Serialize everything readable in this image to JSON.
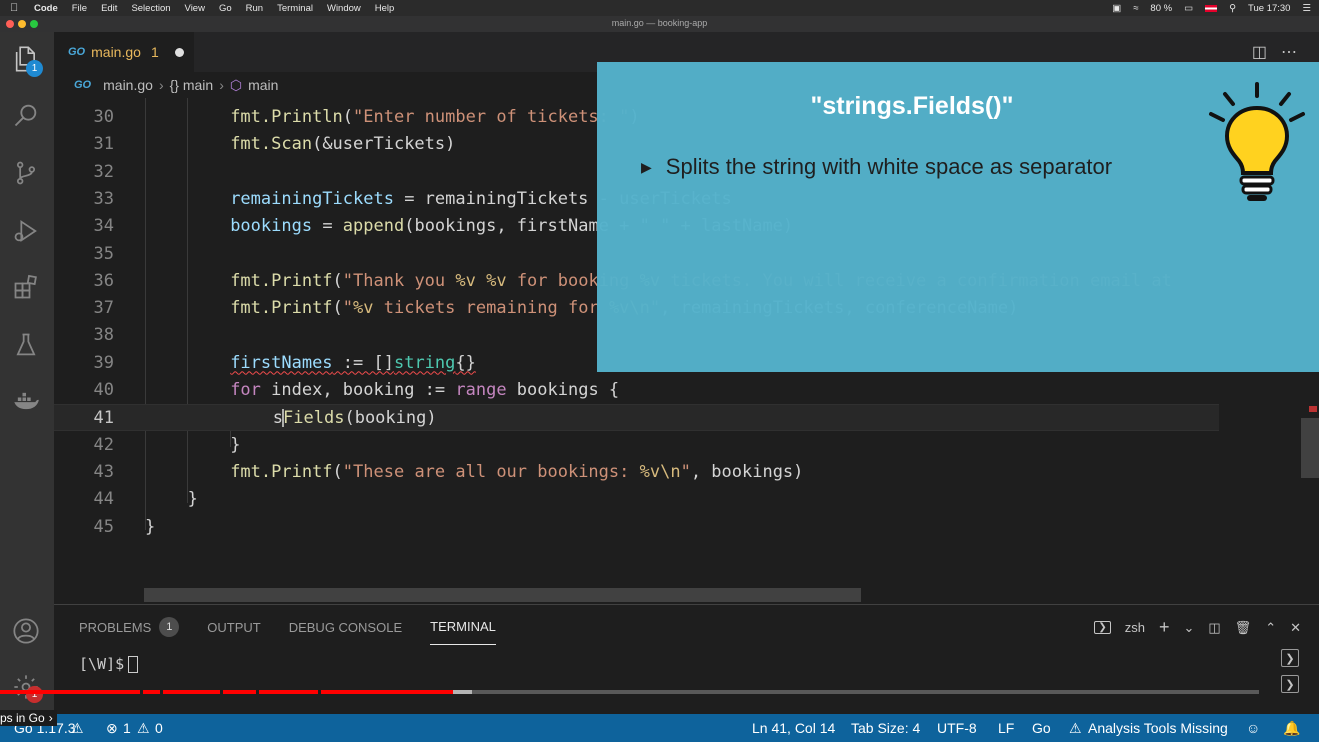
{
  "macos_menubar": {
    "app": "Code",
    "menus": [
      "File",
      "Edit",
      "Selection",
      "View",
      "Go",
      "Run",
      "Terminal",
      "Window",
      "Help"
    ],
    "battery": "80 %",
    "clock": "Tue 17:30"
  },
  "window": {
    "title": "main.go — booking-app"
  },
  "activity_bar": {
    "explorer_badge": "1",
    "settings_badge": "1"
  },
  "tabs": [
    {
      "icon_text": "GO",
      "label": "main.go",
      "problem_count": "1"
    }
  ],
  "breadcrumb": {
    "file": "main.go",
    "func_scope": "{} main",
    "symbol": "main"
  },
  "editor": {
    "lines": [
      {
        "num": "30",
        "tokens": [
          [
            "fn",
            "fmt.Println"
          ],
          [
            "pl",
            "("
          ],
          [
            "str",
            "\"Enter number of tickets: \""
          ],
          [
            "pl",
            ")"
          ]
        ]
      },
      {
        "num": "31",
        "tokens": [
          [
            "fn",
            "fmt.Scan"
          ],
          [
            "pl",
            "(&userTickets)"
          ]
        ]
      },
      {
        "num": "32",
        "tokens": []
      },
      {
        "num": "33",
        "tokens": [
          [
            "var",
            "remainingTickets"
          ],
          [
            "pl",
            " = remainingTickets - userTickets"
          ]
        ]
      },
      {
        "num": "34",
        "tokens": [
          [
            "var",
            "bookings"
          ],
          [
            "pl",
            " = "
          ],
          [
            "fn",
            "append"
          ],
          [
            "pl",
            "(bookings, firstName + \" \" + lastName)"
          ]
        ]
      },
      {
        "num": "35",
        "tokens": []
      },
      {
        "num": "36",
        "tokens": [
          [
            "fn",
            "fmt.Printf"
          ],
          [
            "pl",
            "("
          ],
          [
            "str",
            "\"Thank you "
          ],
          [
            "esc",
            "%v %v"
          ],
          [
            "str",
            " for booking "
          ],
          [
            "esc",
            "%v"
          ],
          [
            "str",
            " tickets. You will receive a confirmation email at"
          ]
        ]
      },
      {
        "num": "37",
        "tokens": [
          [
            "fn",
            "fmt.Printf"
          ],
          [
            "pl",
            "("
          ],
          [
            "str",
            "\""
          ],
          [
            "esc",
            "%v"
          ],
          [
            "str",
            " tickets remaining for "
          ],
          [
            "esc",
            "%v\\n"
          ],
          [
            "str",
            "\""
          ],
          [
            "pl",
            ", remainingTickets, conferenceName)"
          ]
        ]
      },
      {
        "num": "38",
        "tokens": []
      },
      {
        "num": "39",
        "tokens": [
          [
            "var",
            "firstNames"
          ],
          [
            "pl",
            " := []"
          ],
          [
            "type",
            "string"
          ],
          [
            "pl",
            "{}"
          ]
        ]
      },
      {
        "num": "40",
        "tokens": [
          [
            "kw",
            "for"
          ],
          [
            "pl",
            " index, booking := "
          ],
          [
            "kw",
            "range"
          ],
          [
            "pl",
            " bookings {"
          ]
        ]
      },
      {
        "num": "41",
        "tokens": [
          [
            "pl",
            "s"
          ],
          [
            "fn",
            "Fields"
          ],
          [
            "pl",
            "(booking)"
          ]
        ]
      },
      {
        "num": "42",
        "tokens": [
          [
            "pl",
            "}"
          ]
        ]
      },
      {
        "num": "43",
        "tokens": [
          [
            "fn",
            "fmt.Printf"
          ],
          [
            "pl",
            "("
          ],
          [
            "str",
            "\"These are all our bookings: "
          ],
          [
            "esc",
            "%v\\n"
          ],
          [
            "str",
            "\""
          ],
          [
            "pl",
            ", bookings)"
          ]
        ]
      },
      {
        "num": "44",
        "tokens": [
          [
            "pl",
            "}"
          ]
        ]
      },
      {
        "num": "45",
        "tokens": [
          [
            "pl",
            "}"
          ]
        ]
      }
    ]
  },
  "overlay": {
    "title": "\"strings.Fields()\"",
    "bullet": "Splits the string with white space as separator"
  },
  "panel": {
    "tabs": [
      "PROBLEMS",
      "OUTPUT",
      "DEBUG CONSOLE",
      "TERMINAL"
    ],
    "problems_count": "1",
    "active_tab": "TERMINAL",
    "shell": "zsh",
    "prompt": "[\\W]$"
  },
  "video": {
    "chapter_label": "ps in Go",
    "progress": 0.36,
    "buffered": 0.375
  },
  "statusbar": {
    "go_version": "Go 1.17.3",
    "errors": "1",
    "warnings": "0",
    "position": "Ln 41, Col 14",
    "tab_size": "Tab Size: 4",
    "encoding": "UTF-8",
    "eol": "LF",
    "language": "Go",
    "analysis": "Analysis Tools Missing"
  },
  "colors": {
    "accent_status": "#0e639c",
    "overlay": "#54b2cb",
    "modified_tab": "#e8b85d",
    "progress": "#ff0000"
  }
}
